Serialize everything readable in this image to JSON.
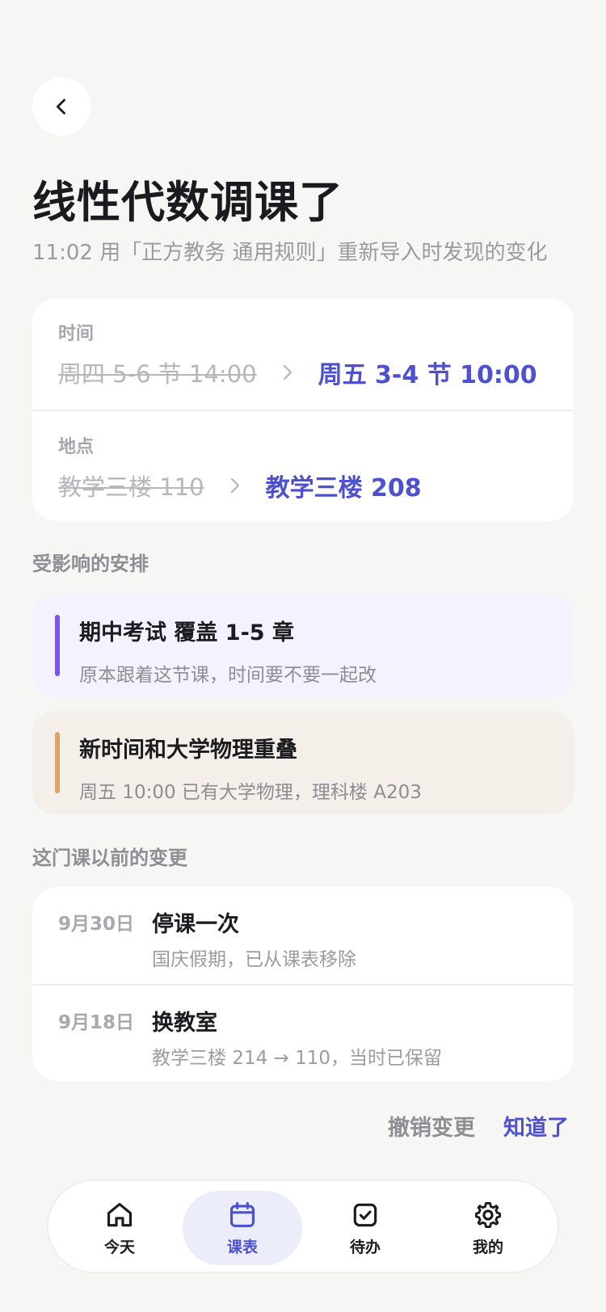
{
  "header": {
    "back_icon": "chevron-left-icon",
    "title": "线性代数调课了",
    "subtitle": "11:02 用「正方教务 通用规则」重新导入时发现的变化"
  },
  "change": {
    "time": {
      "label": "时间",
      "old": "周四 5-6 节 14:00",
      "new": "周五 3-4 节 10:00"
    },
    "location": {
      "label": "地点",
      "old": "教学三楼 110",
      "new": "教学三楼 208"
    }
  },
  "affected": {
    "section_title": "受影响的安排",
    "items": [
      {
        "title": "期中考试 覆盖 1-5 章",
        "desc": "原本跟着这节课，时间要不要一起改",
        "accent": "#7d55e6"
      },
      {
        "title": "新时间和大学物理重叠",
        "desc": "周五 10:00 已有大学物理，理科楼 A203",
        "accent": "#e0a35f"
      }
    ]
  },
  "history": {
    "section_title": "这门课以前的变更",
    "items": [
      {
        "date": "9月30日",
        "title": "停课一次",
        "desc": "国庆假期，已从课表移除"
      },
      {
        "date": "9月18日",
        "title": "换教室",
        "desc": "教学三楼 214 → 110，当时已保留"
      }
    ]
  },
  "actions": {
    "undo": "撤销变更",
    "ok": "知道了"
  },
  "tabbar": {
    "items": [
      {
        "label": "今天",
        "icon": "home-icon",
        "active": false
      },
      {
        "label": "课表",
        "icon": "calendar-icon",
        "active": true
      },
      {
        "label": "待办",
        "icon": "checkbox-icon",
        "active": false
      },
      {
        "label": "我的",
        "icon": "gear-icon",
        "active": false
      }
    ]
  },
  "colors": {
    "accent": "#4d50cf",
    "background": "#f6f6f5"
  }
}
